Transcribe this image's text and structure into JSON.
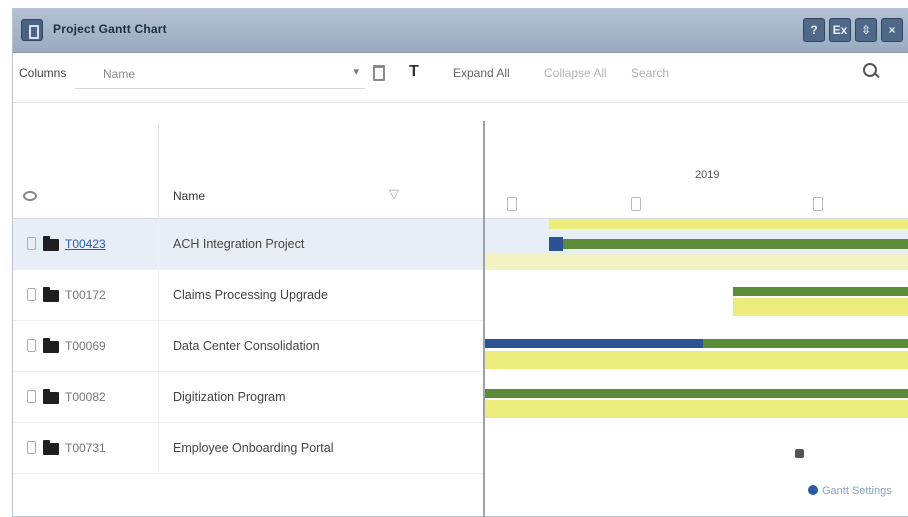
{
  "window": {
    "title": "Project Gantt Chart",
    "buttons": [
      "?",
      "Ex",
      "⇳",
      "×"
    ]
  },
  "toolbar": {
    "columns_label": "Columns",
    "columns_value": "Name",
    "expand_all": "Expand All",
    "collapse_all": "Collapse All",
    "search": "Search"
  },
  "grid": {
    "name_header": "Name",
    "rows": [
      {
        "id": "T00423",
        "name": "ACH Integration Project",
        "selected": true
      },
      {
        "id": "T00172",
        "name": "Claims Processing Upgrade",
        "selected": false
      },
      {
        "id": "T00069",
        "name": "Data Center Consolidation",
        "selected": false
      },
      {
        "id": "T00082",
        "name": "Digitization Program",
        "selected": false
      },
      {
        "id": "T00731",
        "name": "Employee Onboarding Portal",
        "selected": false
      }
    ]
  },
  "gantt": {
    "year_label": "2019",
    "colors": {
      "progress": "#2c5296",
      "actual": "#5c8c3a",
      "baseline": "#ecec7c",
      "baseline_light": "#f2f2c4"
    }
  },
  "footer": {
    "settings_label": "Gantt Settings"
  }
}
